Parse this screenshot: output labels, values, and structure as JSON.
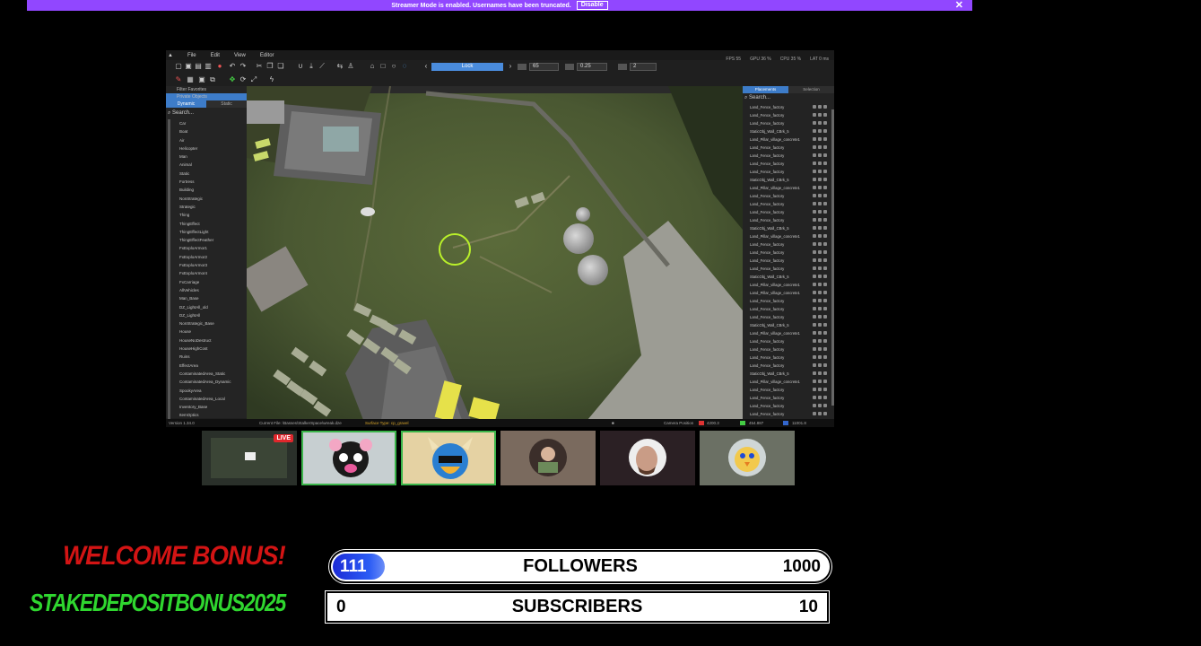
{
  "banner": {
    "text": "Streamer Mode is enabled. Usernames have been truncated.",
    "disable_label": "Disable",
    "close": "✕"
  },
  "editor": {
    "menu": [
      "File",
      "Edit",
      "View",
      "Editor"
    ],
    "stats": {
      "fps": "FPS  55",
      "gpu": "GPU  36 %",
      "cpu": "CPU  35 %",
      "lat": "LAT  0 ms"
    },
    "lock_label": "Lock",
    "fields": [
      "65",
      "0.25",
      "2"
    ],
    "left_tabs": [
      "Dynamic",
      "Static"
    ],
    "filter_labels": [
      "Filter Favorites",
      "Private Objects"
    ],
    "search_placeholder": "Search...",
    "categories": [
      "Car",
      "Boat",
      "Air",
      "Helicopter",
      "Man",
      "Animal",
      "Static",
      "Fortress",
      "Building",
      "NonStrategic",
      "Strategic",
      "Thing",
      "ThingEffect",
      "ThingEffectLight",
      "ThingEffectFeather",
      "FxExploArmor1",
      "FxExploArmor2",
      "FxExploArmor3",
      "FxExploArmor4",
      "FxCarriage",
      "AllVehicles",
      "Man_Base",
      "DZ_LightAll_old",
      "DZ_LightAll",
      "NonStrategic_Base",
      "House",
      "HouseNoDestruct",
      "HouseHighCost",
      "Ruins",
      "EffectArea",
      "ContaminatedArea_Static",
      "ContaminatedArea_Dynamic",
      "SpookyArea",
      "ContaminatedArea_Local",
      "Inventory_Base",
      "ItemOptics"
    ],
    "right_tabs": [
      "Placements",
      "Selection"
    ],
    "placements": [
      "Land_Fence_factory",
      "Land_Fence_factory",
      "Land_Fence_factory",
      "StaticObj_Wall_CBrk_5",
      "Land_Pillar_village_concrete1",
      "Land_Fence_factory",
      "Land_Fence_factory",
      "Land_Fence_factory",
      "Land_Fence_factory",
      "StaticObj_Wall_CBrk_5",
      "Land_Pillar_village_concrete1",
      "Land_Fence_factory",
      "Land_Fence_factory",
      "Land_Fence_factory",
      "Land_Fence_factory",
      "StaticObj_Wall_CBrk_5",
      "Land_Pillar_village_concrete1",
      "Land_Fence_factory",
      "Land_Fence_factory",
      "Land_Fence_factory",
      "Land_Fence_factory",
      "StaticObj_Wall_CBrk_5",
      "Land_Pillar_village_concrete1",
      "Land_Pillar_village_concrete1",
      "Land_Fence_factory",
      "Land_Fence_factory",
      "Land_Fence_factory",
      "StaticObj_Wall_CBrk_5",
      "Land_Pillar_village_concrete1",
      "Land_Fence_factory",
      "Land_Fence_factory",
      "Land_Fence_factory",
      "Land_Fence_factory",
      "StaticObj_Wall_CBrk_5",
      "Land_Pillar_village_concrete1",
      "Land_Fence_factory",
      "Land_Fence_factory",
      "Land_Fence_factory",
      "Land_Fence_factory"
    ],
    "status": {
      "version": "Version   1.34.0",
      "file": "Current File: \\Basses\\StalkerSpace\\wreak.dze",
      "surface": "Surface Type: cp_gravel",
      "camera_label": "Camera Position",
      "x": "4200.3",
      "y": "454.887",
      "z": "11001.8"
    }
  },
  "cams": {
    "live_label": "LIVE"
  },
  "bonus": {
    "title": "WELCOME BONUS!",
    "code": "STAKEDEPOSITBONUS2025"
  },
  "goals": {
    "followers": {
      "current": "111",
      "label": "FOLLOWERS",
      "max": "1000",
      "progress": 0.111
    },
    "subscribers": {
      "current": "0",
      "label": "SUBSCRIBERS",
      "max": "10",
      "progress": 0
    }
  },
  "colors": {
    "banner": "#9147ff",
    "accent": "#3d7cc9",
    "bonus_title": "#d31414",
    "bonus_code": "#2fd62f",
    "goal_fill": "#2b5cf5"
  }
}
